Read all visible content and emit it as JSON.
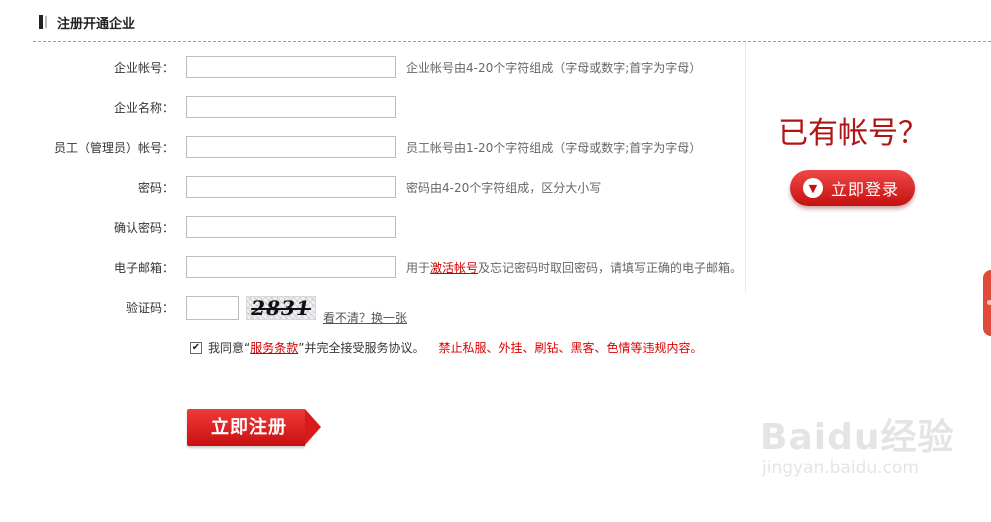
{
  "header": {
    "title": "注册开通企业"
  },
  "form": {
    "fields": [
      {
        "label": "企业帐号：",
        "value": "",
        "hint": "企业帐号由4-20个字符组成（字母或数字;首字为字母）"
      },
      {
        "label": "企业名称：",
        "value": "",
        "hint": ""
      },
      {
        "label": "员工（管理员）帐号：",
        "value": "",
        "hint": "员工帐号由1-20个字符组成（字母或数字;首字为字母）"
      },
      {
        "label": "密码：",
        "value": "",
        "hint": "密码由4-20个字符组成，区分大小写"
      },
      {
        "label": "确认密码：",
        "value": "",
        "hint": ""
      },
      {
        "label": "电子邮箱：",
        "value": "",
        "hint_before": "用于",
        "hint_link": "激活帐号",
        "hint_after": "及忘记密码时取回密码，请填写正确的电子邮箱。"
      }
    ],
    "captcha": {
      "label": "验证码：",
      "value": "",
      "image_text": "2831",
      "refresh": "看不清？换一张"
    },
    "agree": {
      "checked": true,
      "before": "我同意“",
      "terms": "服务条款",
      "after": "”并完全接受服务协议。",
      "warning": "禁止私服、外挂、刷钻、黑客、色情等违规内容。"
    },
    "submit": "立即注册"
  },
  "sidebar": {
    "have_account": "已有帐号？",
    "login": "立即登录"
  },
  "watermark": {
    "logo": "Baidu经验",
    "url": "jingyan.baidu.com"
  }
}
